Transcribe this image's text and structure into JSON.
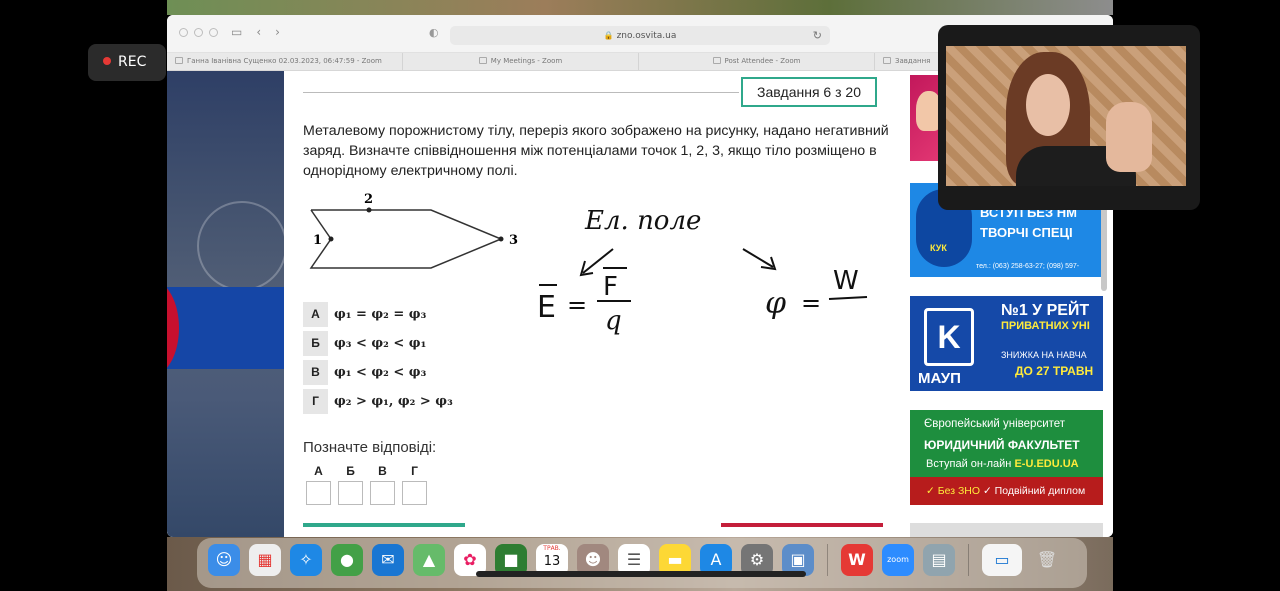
{
  "recording": {
    "label": "REC"
  },
  "browser": {
    "address": "zno.osvita.ua",
    "tabs": [
      "Ганна Іванівна Сущенко 02.03.2023, 06:47:59 - Zoom",
      "My Meetings - Zoom",
      "Post Attendee - Zoom",
      "Завдання"
    ]
  },
  "task": {
    "counter": "Завдання 6 з 20",
    "question": "Металевому порожнистому тілу, переріз якого зображено на рисунку, надано негативний заряд. Визначте співвідношення між потенціалами точок 1, 2, 3, якщо тіло розміщено в однорідному електричному полі.",
    "figure_labels": {
      "p1": "1",
      "p2": "2",
      "p3": "3"
    },
    "options": [
      {
        "letter": "А",
        "formula": "φ₁ = φ₂ = φ₃"
      },
      {
        "letter": "Б",
        "formula": "φ₃ < φ₂ < φ₁"
      },
      {
        "letter": "В",
        "formula": "φ₁ < φ₂ < φ₃"
      },
      {
        "letter": "Г",
        "formula": "φ₂ > φ₁, φ₂ > φ₃"
      }
    ],
    "mark_label": "Позначте відповіді:",
    "answer_letters": [
      "А",
      "Б",
      "В",
      "Г"
    ]
  },
  "handwriting": {
    "line1": "Ел. поле",
    "eq1_left": "E",
    "eq1_num": "F",
    "eq1_den": "q",
    "eq2_left": "φ",
    "eq2_num": "W"
  },
  "ads": {
    "ad2": {
      "line1": "ВСТУП БЕЗ НМ",
      "line2": "ТВОРЧІ СПЕЦІ",
      "phone": "тел.: (063) 258-63-27; (098) 597-",
      "brand": "КУК"
    },
    "ad3": {
      "brand": "МАУП",
      "line1": "№1 У РЕЙТ",
      "line2": "ПРИВАТНИХ УНІ",
      "line3": "ЗНИЖКА НА НАВЧА",
      "line4": "ДО 27 ТРАВН"
    },
    "ad4": {
      "line1": "Європейський університет",
      "line2": "ЮРИДИЧНИЙ ФАКУЛЬТЕТ",
      "line3_a": "Вступай он-лайн ",
      "line3_b": "E-U.EDU.UA",
      "foot_a": "✓ Без ЗНО ",
      "foot_b": "✓ Подвійний диплом"
    }
  },
  "dock": {
    "calendar_month": "ТРАВ.",
    "calendar_day": "13",
    "zoom_label": "zoom"
  },
  "colors": {
    "accent": "#2fa88b",
    "rec_dot": "#e53935",
    "ad_red": "#c41e3a"
  }
}
